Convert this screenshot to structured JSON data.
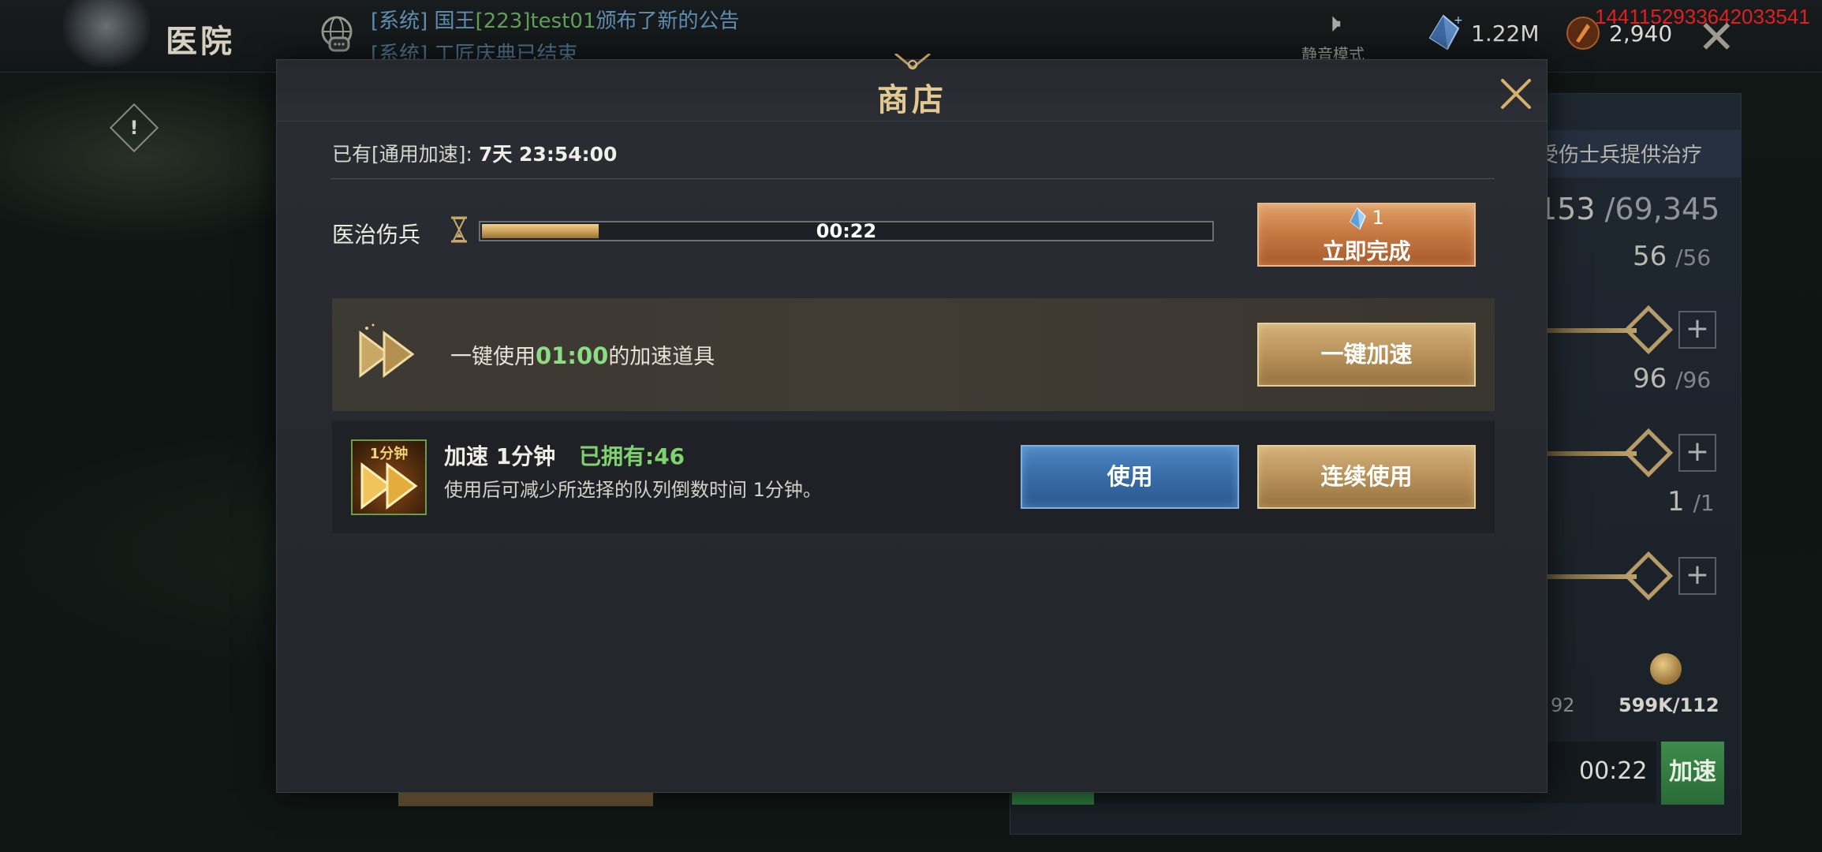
{
  "background": {
    "page_title": "医院",
    "chat": [
      {
        "prefix": "[系统] 国王",
        "highlight": "[223]test01",
        "suffix": "颁布了新的公告"
      },
      {
        "prefix": "[系统] 工匠庆典已结束",
        "highlight": "",
        "suffix": ""
      }
    ],
    "mute_label": "静音模式",
    "gem_amount": "1.22M",
    "food_amount": "2,940",
    "debug_id": "1441152933642033541",
    "panel": {
      "description": "受伤士兵提供治疗",
      "count_current": "153",
      "count_max": "/69,345",
      "rows": [
        {
          "value": "56",
          "max": "/56"
        },
        {
          "value": "96",
          "max": "/96"
        },
        {
          "value": "1",
          "max": "/1"
        }
      ],
      "cost_a": "92",
      "cost_b": "599K/112",
      "timer": "00:22",
      "speed_button": "加速"
    }
  },
  "modal": {
    "title": "商店",
    "owned_label": "已有[通用加速]:",
    "owned_value": "7天 23:54:00",
    "task": {
      "label": "医治伤兵",
      "timer": "00:22",
      "progress": 0.16
    },
    "finish_button": {
      "cost": "1",
      "label": "立即完成"
    },
    "one_click": {
      "text_before": "一键使用",
      "time": "01:00",
      "text_after": "的加速道具",
      "button": "一键加速"
    },
    "item": {
      "icon_tag": "1分钟",
      "name": "加速 1分钟",
      "owned": "已拥有:46",
      "description": "使用后可减少所选择的队列倒数时间 1分钟。",
      "use_button": "使用",
      "continuous_button": "连续使用"
    }
  },
  "colors": {
    "modal_bg": "#2a2d33",
    "title_gold": "#e3c891",
    "accent_green": "#7fd36e",
    "button_blue": "#3a6ea8",
    "button_orange": "#c87a44",
    "button_gold": "#b89159"
  },
  "icons": [
    "helmet-icon",
    "chat-icon",
    "mute-icon",
    "gem-icon",
    "food-icon",
    "close-icon",
    "hourglass-icon",
    "diamond-icon",
    "fast-forward-icon",
    "alert-icon",
    "coin-icon"
  ]
}
